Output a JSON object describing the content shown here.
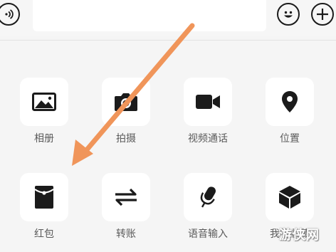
{
  "toolbar": {
    "voice_icon": "voice-toggle-icon",
    "emoji_icon": "emoji-icon",
    "more_icon": "plus-icon",
    "input_value": ""
  },
  "panel": {
    "items": [
      {
        "label": "相册",
        "icon": "photo-album-icon"
      },
      {
        "label": "拍摄",
        "icon": "camera-icon"
      },
      {
        "label": "视频通话",
        "icon": "video-call-icon"
      },
      {
        "label": "位置",
        "icon": "location-pin-icon"
      },
      {
        "label": "红包",
        "icon": "red-packet-icon"
      },
      {
        "label": "转账",
        "icon": "transfer-icon"
      },
      {
        "label": "语音输入",
        "icon": "microphone-icon"
      },
      {
        "label": "我的收藏",
        "icon": "favorites-cube-icon"
      }
    ]
  },
  "annotation": {
    "arrow_color": "#f0955a"
  },
  "watermark": {
    "text": "游侠网"
  }
}
